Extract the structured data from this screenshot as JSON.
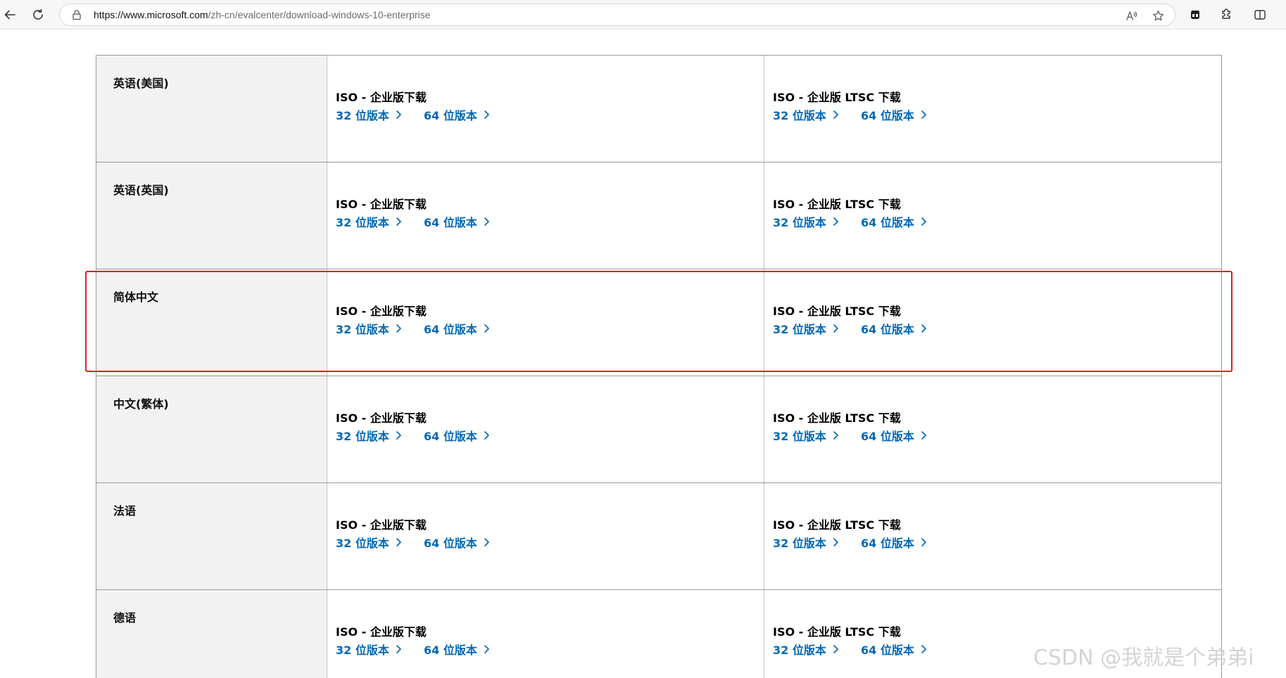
{
  "browser": {
    "url_host": "https://www.microsoft.com",
    "url_path": "/zh-cn/evalcenter/download-windows-10-enterprise"
  },
  "table": {
    "rows": [
      {
        "language": "英语(美国)",
        "enterprise": {
          "title": "ISO - 企业版下载",
          "link32": "32 位版本",
          "link64": "64 位版本"
        },
        "ltsc": {
          "title": "ISO - 企业版 LTSC 下载",
          "link32": "32 位版本",
          "link64": "64 位版本"
        }
      },
      {
        "language": "英语(英国)",
        "enterprise": {
          "title": "ISO - 企业版下载",
          "link32": "32 位版本",
          "link64": "64 位版本"
        },
        "ltsc": {
          "title": "ISO - 企业版 LTSC 下载",
          "link32": "32 位版本",
          "link64": "64 位版本"
        }
      },
      {
        "language": "简体中文",
        "enterprise": {
          "title": "ISO - 企业版下载",
          "link32": "32 位版本",
          "link64": "64 位版本"
        },
        "ltsc": {
          "title": "ISO - 企业版 LTSC 下载",
          "link32": "32 位版本",
          "link64": "64 位版本"
        }
      },
      {
        "language": "中文(繁体)",
        "enterprise": {
          "title": "ISO - 企业版下载",
          "link32": "32 位版本",
          "link64": "64 位版本"
        },
        "ltsc": {
          "title": "ISO - 企业版 LTSC 下载",
          "link32": "32 位版本",
          "link64": "64 位版本"
        }
      },
      {
        "language": "法语",
        "enterprise": {
          "title": "ISO - 企业版下载",
          "link32": "32 位版本",
          "link64": "64 位版本"
        },
        "ltsc": {
          "title": "ISO - 企业版 LTSC 下载",
          "link32": "32 位版本",
          "link64": "64 位版本"
        }
      },
      {
        "language": "德语",
        "enterprise": {
          "title": "ISO - 企业版下载",
          "link32": "32 位版本",
          "link64": "64 位版本"
        },
        "ltsc": {
          "title": "ISO - 企业版 LTSC 下载",
          "link32": "32 位版本",
          "link64": "64 位版本"
        }
      }
    ]
  },
  "watermark": "CSDN @我就是个弟弟i",
  "colors": {
    "link": "#0067b8",
    "highlight": "#e51d1d",
    "language_cell_bg": "#f2f2f2"
  },
  "icons": {
    "back": "back-arrow-icon",
    "refresh": "refresh-icon",
    "lock": "lock-icon",
    "read_aloud": "read-aloud-icon",
    "favorite": "star-icon",
    "chevron": "chevron-right-icon"
  }
}
